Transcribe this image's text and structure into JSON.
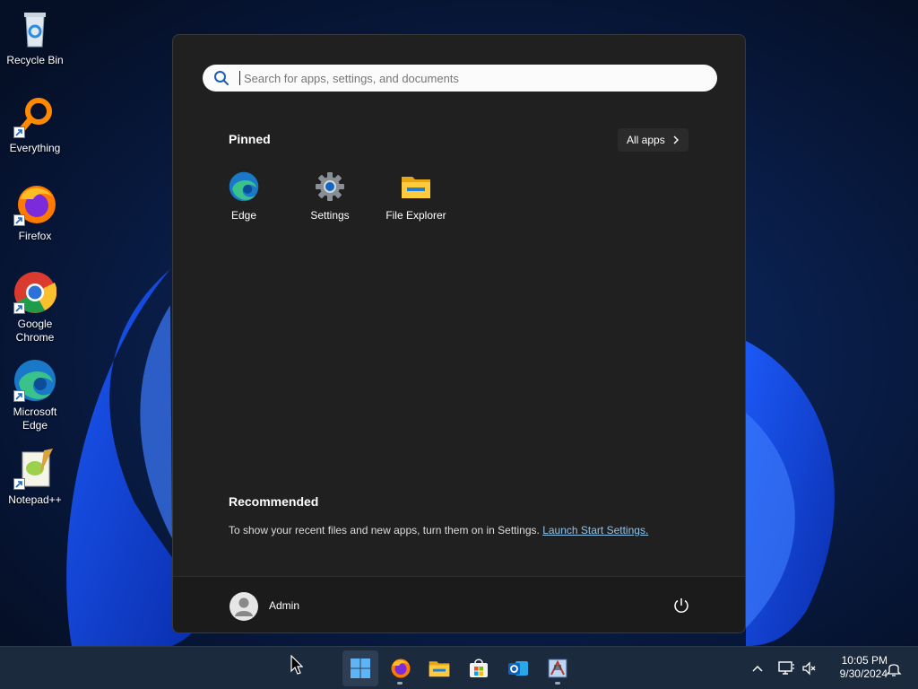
{
  "desktop": {
    "icons": [
      {
        "label": "Recycle Bin"
      },
      {
        "label": "Everything"
      },
      {
        "label": "Firefox"
      },
      {
        "label": "Google Chrome"
      },
      {
        "label": "Microsoft Edge"
      },
      {
        "label": "Notepad++"
      }
    ]
  },
  "start_menu": {
    "search": {
      "placeholder": "Search for apps, settings, and documents"
    },
    "pinned_title": "Pinned",
    "all_apps_label": "All apps",
    "pinned": [
      {
        "label": "Edge",
        "icon": "edge-icon"
      },
      {
        "label": "Settings",
        "icon": "settings-gear-icon"
      },
      {
        "label": "File Explorer",
        "icon": "folder-icon"
      }
    ],
    "recommended_title": "Recommended",
    "recommended_text": "To show your recent files and new apps, turn them on in Settings.",
    "recommended_link": "Launch Start Settings.",
    "user_name": "Admin"
  },
  "taskbar": {
    "apps": [
      "start-icon",
      "firefox-icon",
      "file-explorer-icon",
      "microsoft-store-icon",
      "outlook-icon",
      "app-icon"
    ],
    "clock": {
      "time": "10:05 PM",
      "date": "9/30/2024"
    }
  },
  "colors": {
    "accent": "#5db5f5",
    "link": "#8fc4ea",
    "menu_bg": "#202020"
  }
}
